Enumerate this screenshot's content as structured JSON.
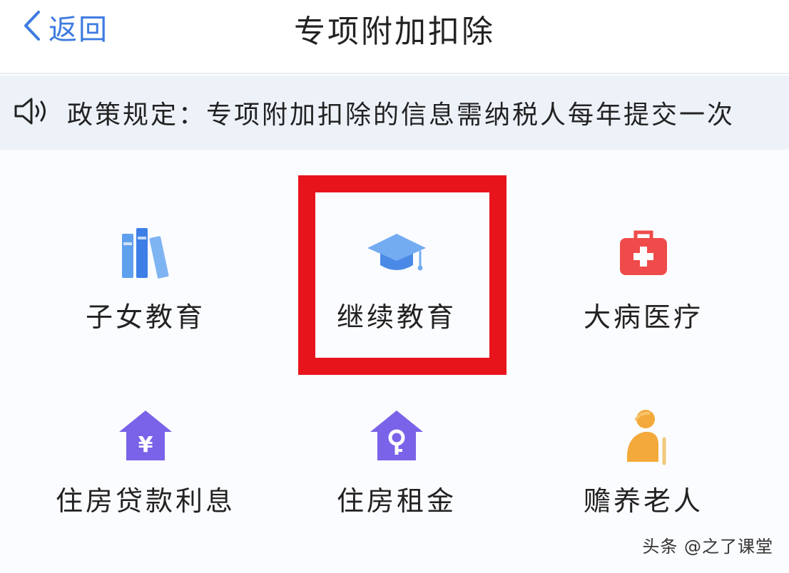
{
  "nav": {
    "back_label": "返回",
    "title": "专项附加扣除"
  },
  "notice": {
    "text": "政策规定：专项附加扣除的信息需纳税人每年提交一次"
  },
  "items": [
    {
      "label": "子女教育",
      "icon": "books-icon"
    },
    {
      "label": "继续教育",
      "icon": "graduation-cap-icon"
    },
    {
      "label": "大病医疗",
      "icon": "medical-kit-icon"
    },
    {
      "label": "住房贷款利息",
      "icon": "house-yen-icon"
    },
    {
      "label": "住房租金",
      "icon": "house-key-icon"
    },
    {
      "label": "赡养老人",
      "icon": "elderly-person-icon"
    }
  ],
  "highlight_color": "#e8141c",
  "accent_color": "#3e7be0",
  "watermark": "头条 @之了课堂"
}
